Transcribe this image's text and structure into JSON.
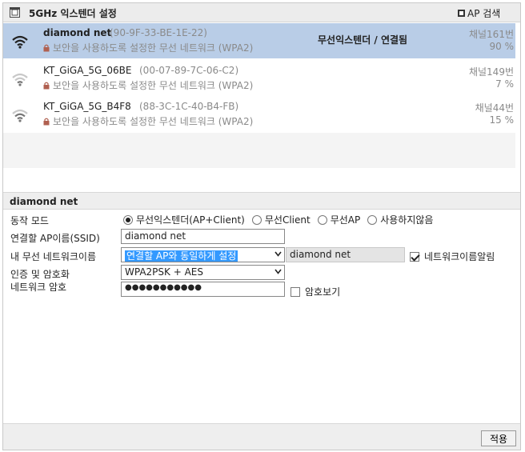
{
  "header": {
    "title": "5GHz 익스텐더 설정",
    "ap_search_label": "AP 검색"
  },
  "ap_list": [
    {
      "ssid": "diamond net",
      "mac": "(90-9F-33-BE-1E-22)",
      "security": "보안을 사용하도록 설정한 무선 네트워크 (WPA2)",
      "status": "무선익스텐더 / 연결됨",
      "channel": "채널161번",
      "signal": "90 %",
      "selected": true
    },
    {
      "ssid": "KT_GiGA_5G_06BE",
      "mac": "(00-07-89-7C-06-C2)",
      "security": "보안을 사용하도록 설정한 무선 네트워크 (WPA2)",
      "status": "",
      "channel": "채널149번",
      "signal": "7 %",
      "selected": false
    },
    {
      "ssid": "KT_GiGA_5G_B4F8",
      "mac": "(88-3C-1C-40-B4-FB)",
      "security": "보안을 사용하도록 설정한 무선 네트워크 (WPA2)",
      "status": "",
      "channel": "채널44번",
      "signal": "15 %",
      "selected": false
    }
  ],
  "detail": {
    "title": "diamond net",
    "mode_label": "동작 모드",
    "mode_options": [
      "무선익스텐더(AP+Client)",
      "무선Client",
      "무선AP",
      "사용하지않음"
    ],
    "mode_selected": "무선익스텐더(AP+Client)",
    "ssid_label": "연결할 AP이름(SSID)",
    "ssid_value": "diamond net",
    "my_network_label": "내 무선 네트워크이름",
    "my_network_option": "연결할 AP와 동일하게 설정",
    "my_network_value": "diamond net",
    "notify_label": "네트워크이름알림",
    "notify_checked": true,
    "auth_label": "인증 및 암호화",
    "auth_value": "WPA2PSK + AES",
    "password_label": "네트워크 암호",
    "password_value": "●●●●●●●●●●●",
    "show_password_label": "암호보기",
    "show_password_checked": false
  },
  "footer": {
    "apply_label": "적용"
  },
  "colors": {
    "selected_row": "#b9cde7",
    "header_bg": "#ececec",
    "highlight": "#3399ff"
  }
}
